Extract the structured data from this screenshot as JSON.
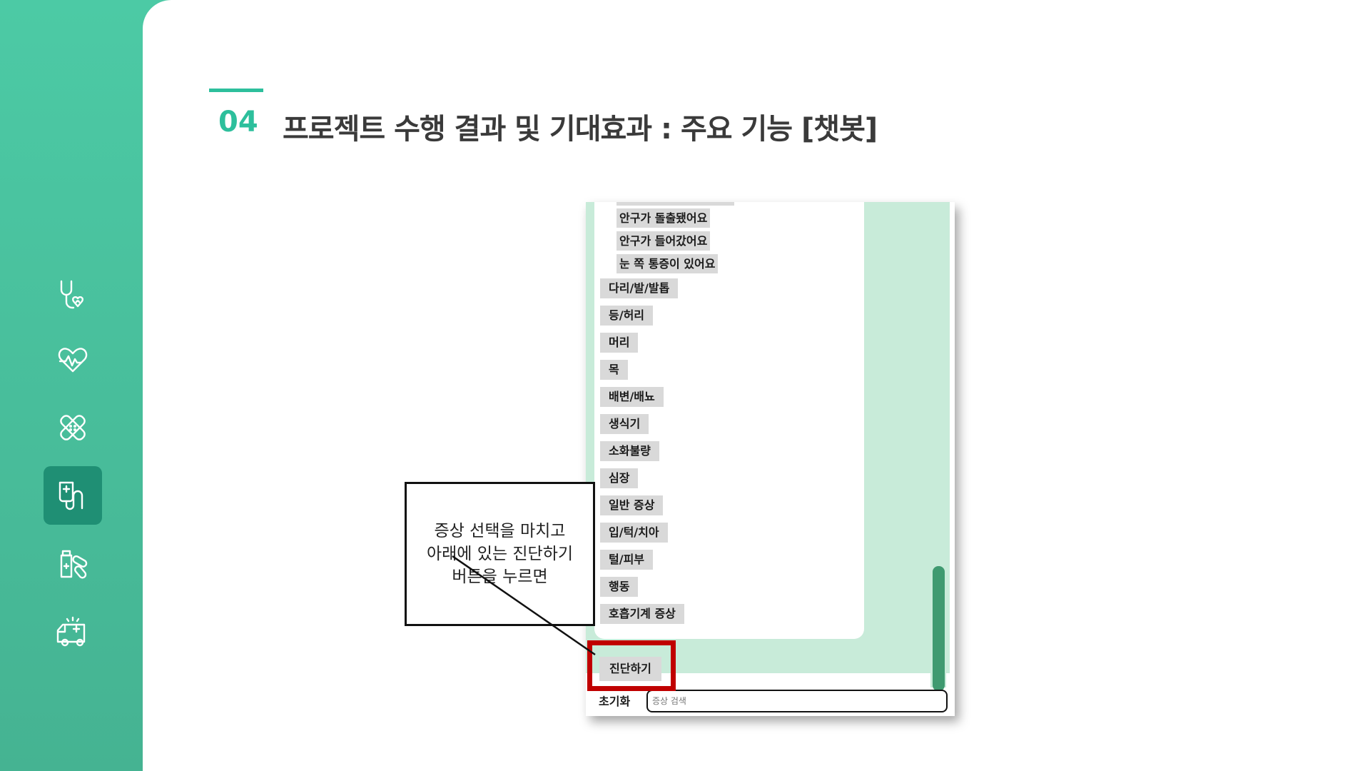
{
  "slide": {
    "section_number": "04",
    "title": "프로젝트 수행 결과 및 기대효과 : 주요 기능 [챗봇]"
  },
  "sidebar": {
    "items": [
      {
        "icon": "stethoscope-heart-icon"
      },
      {
        "icon": "heartbeat-icon"
      },
      {
        "icon": "bandage-icon"
      },
      {
        "icon": "iv-drip-icon",
        "active": true
      },
      {
        "icon": "medicine-bottle-pill-icon"
      },
      {
        "icon": "ambulance-icon"
      }
    ]
  },
  "chatbot": {
    "sub_options": [
      "안구가 돌출됐어요",
      "안구가 들어갔어요",
      "눈 쪽 통증이 있어요"
    ],
    "categories": [
      "다리/발/발톱",
      "등/허리",
      "머리",
      "목",
      "배변/배뇨",
      "생식기",
      "소화불량",
      "심장",
      "일반 증상",
      "입/턱/치아",
      "털/피부",
      "행동",
      "호흡기계 증상"
    ],
    "diagnose_label": "진단하기",
    "reset_label": "초기화",
    "search_placeholder": "증상 검색"
  },
  "callout": {
    "lines": [
      "증상 선택을 마치고",
      "아래에 있는 진단하기",
      "버튼을 누르면"
    ]
  },
  "colors": {
    "sidebar_green": "#4ccaa5",
    "accent": "#2dbf9c",
    "highlight_red": "#c00000",
    "chat_green": "#c8ebd9",
    "scroll_thumb": "#3f9a70"
  }
}
